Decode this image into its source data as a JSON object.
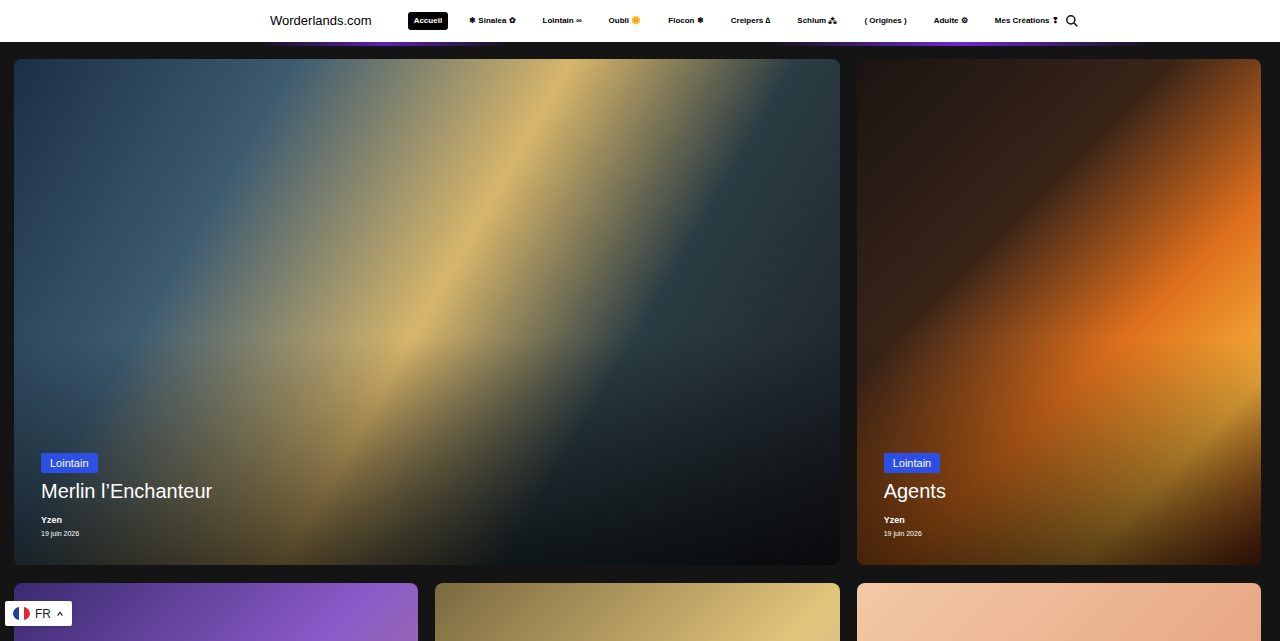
{
  "header": {
    "logo": "Worderlands.com",
    "nav": [
      {
        "label": "Accueil",
        "selected": true
      },
      {
        "label": "❄ Sinalea ✿",
        "selected": false
      },
      {
        "label": "Lointain ∞",
        "selected": false
      },
      {
        "label": "Oubli 🌼",
        "selected": false
      },
      {
        "label": "Flocon ❄",
        "selected": false
      },
      {
        "label": "Creipers ∆",
        "selected": false
      },
      {
        "label": "Schlum ⁂",
        "selected": false
      },
      {
        "label": "( Origines )",
        "selected": false
      },
      {
        "label": "Adulte ⚙",
        "selected": false
      },
      {
        "label": "Mes Créations ❢",
        "selected": false
      }
    ]
  },
  "featured": [
    {
      "category": "Lointain",
      "title": "Merlin l’Enchanteur",
      "author": "Yzen",
      "date": "19 juin 2026"
    },
    {
      "category": "Lointain",
      "title": "Agents",
      "author": "Yzen",
      "date": "19 juin 2026"
    }
  ],
  "language": {
    "code": "FR"
  }
}
